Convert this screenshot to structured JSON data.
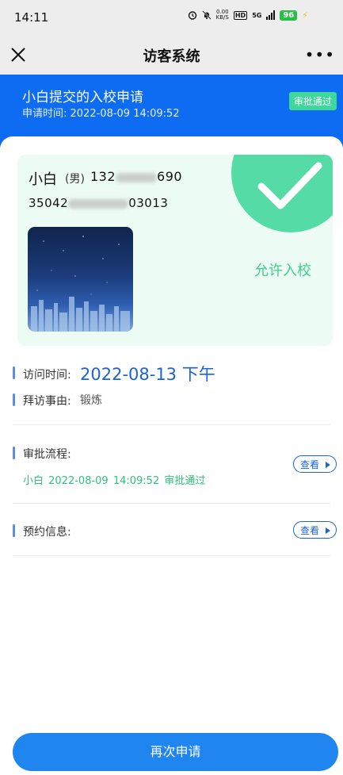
{
  "status_bar": {
    "time": "14:11",
    "network_speed_value": "0.00",
    "network_speed_unit": "KB/S",
    "hd_label": "HD",
    "signal_label": "5G",
    "battery": "96",
    "icons": [
      "alarm-icon",
      "mute-bell-icon",
      "signal-icon",
      "charging-icon"
    ]
  },
  "nav": {
    "title": "访客系统",
    "close_icon": "close-icon",
    "more_icon": "more-icon",
    "more_label": "•••"
  },
  "application": {
    "title": "小白提交的入校申请",
    "apply_time_label": "申请时间:",
    "apply_time": "2022-08-09 14:09:52",
    "status_badge": "审批通过"
  },
  "visitor": {
    "name": "小白",
    "gender": "(男)",
    "phone_prefix": "132",
    "phone_suffix": "690",
    "id_prefix": "35042",
    "id_suffix": "03013",
    "pass_label": "允许入校"
  },
  "visit": {
    "time_label": "访问时间:",
    "time_value": "2022-08-13 下午",
    "reason_label": "拜访事由:",
    "reason_value": "锻炼"
  },
  "approval": {
    "label": "审批流程:",
    "entry_name": "小白",
    "entry_time": "2022-08-09 14:09:52",
    "entry_status": "审批通过",
    "view_label": "查看"
  },
  "reservation": {
    "label": "预约信息:",
    "view_label": "查看"
  },
  "footer": {
    "reapply_label": "再次申请"
  },
  "colors": {
    "primary_blue": "#0d6cf2",
    "button_blue": "#1f86ef",
    "success_green": "#55dca6",
    "pass_card_bg": "#edfbf5",
    "link_blue": "#1b63d6"
  }
}
